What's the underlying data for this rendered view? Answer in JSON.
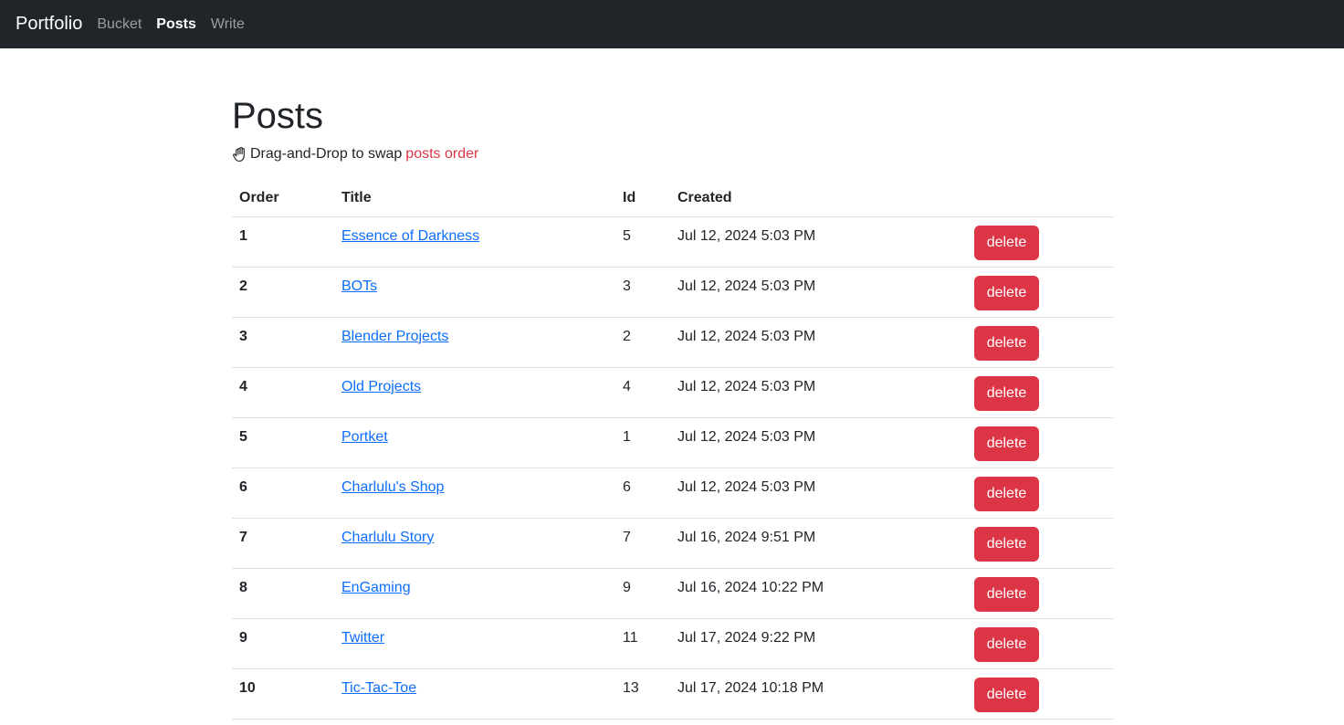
{
  "navbar": {
    "brand": "Portfolio",
    "links": [
      {
        "label": "Bucket",
        "active": false
      },
      {
        "label": "Posts",
        "active": true
      },
      {
        "label": "Write",
        "active": false
      }
    ]
  },
  "page": {
    "title": "Posts",
    "hint_icon": "hand-icon",
    "hint_text": "Drag-and-Drop to swap",
    "hint_accent": "posts order",
    "accent_color": "#dc3545"
  },
  "table": {
    "headers": {
      "order": "Order",
      "title": "Title",
      "id": "Id",
      "created": "Created"
    },
    "delete_label": "delete",
    "rows": [
      {
        "order": "1",
        "title": "Essence of Darkness",
        "id": "5",
        "created": "Jul 12, 2024 5:03 PM"
      },
      {
        "order": "2",
        "title": "BOTs",
        "id": "3",
        "created": "Jul 12, 2024 5:03 PM"
      },
      {
        "order": "3",
        "title": "Blender Projects",
        "id": "2",
        "created": "Jul 12, 2024 5:03 PM"
      },
      {
        "order": "4",
        "title": "Old Projects",
        "id": "4",
        "created": "Jul 12, 2024 5:03 PM"
      },
      {
        "order": "5",
        "title": "Portket",
        "id": "1",
        "created": "Jul 12, 2024 5:03 PM"
      },
      {
        "order": "6",
        "title": "Charlulu's Shop",
        "id": "6",
        "created": "Jul 12, 2024 5:03 PM"
      },
      {
        "order": "7",
        "title": "Charlulu Story",
        "id": "7",
        "created": "Jul 16, 2024 9:51 PM"
      },
      {
        "order": "8",
        "title": "EnGaming",
        "id": "9",
        "created": "Jul 16, 2024 10:22 PM"
      },
      {
        "order": "9",
        "title": "Twitter",
        "id": "11",
        "created": "Jul 17, 2024 9:22 PM"
      },
      {
        "order": "10",
        "title": "Tic-Tac-Toe",
        "id": "13",
        "created": "Jul 17, 2024 10:18 PM"
      }
    ]
  }
}
